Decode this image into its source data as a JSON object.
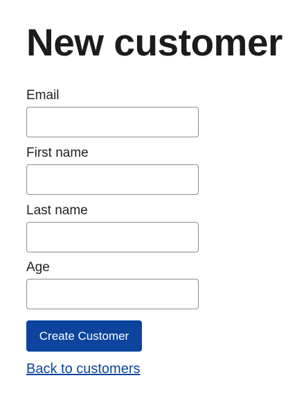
{
  "page": {
    "title": "New customer"
  },
  "form": {
    "fields": [
      {
        "label": "Email",
        "value": "",
        "placeholder": ""
      },
      {
        "label": "First name",
        "value": "",
        "placeholder": ""
      },
      {
        "label": "Last name",
        "value": "",
        "placeholder": ""
      },
      {
        "label": "Age",
        "value": "",
        "placeholder": ""
      }
    ],
    "submit_label": "Create Customer"
  },
  "nav": {
    "back_label": "Back to customers"
  },
  "colors": {
    "accent": "#0c449e",
    "text": "#1f1f1f",
    "input_border": "#8a8a9a"
  }
}
